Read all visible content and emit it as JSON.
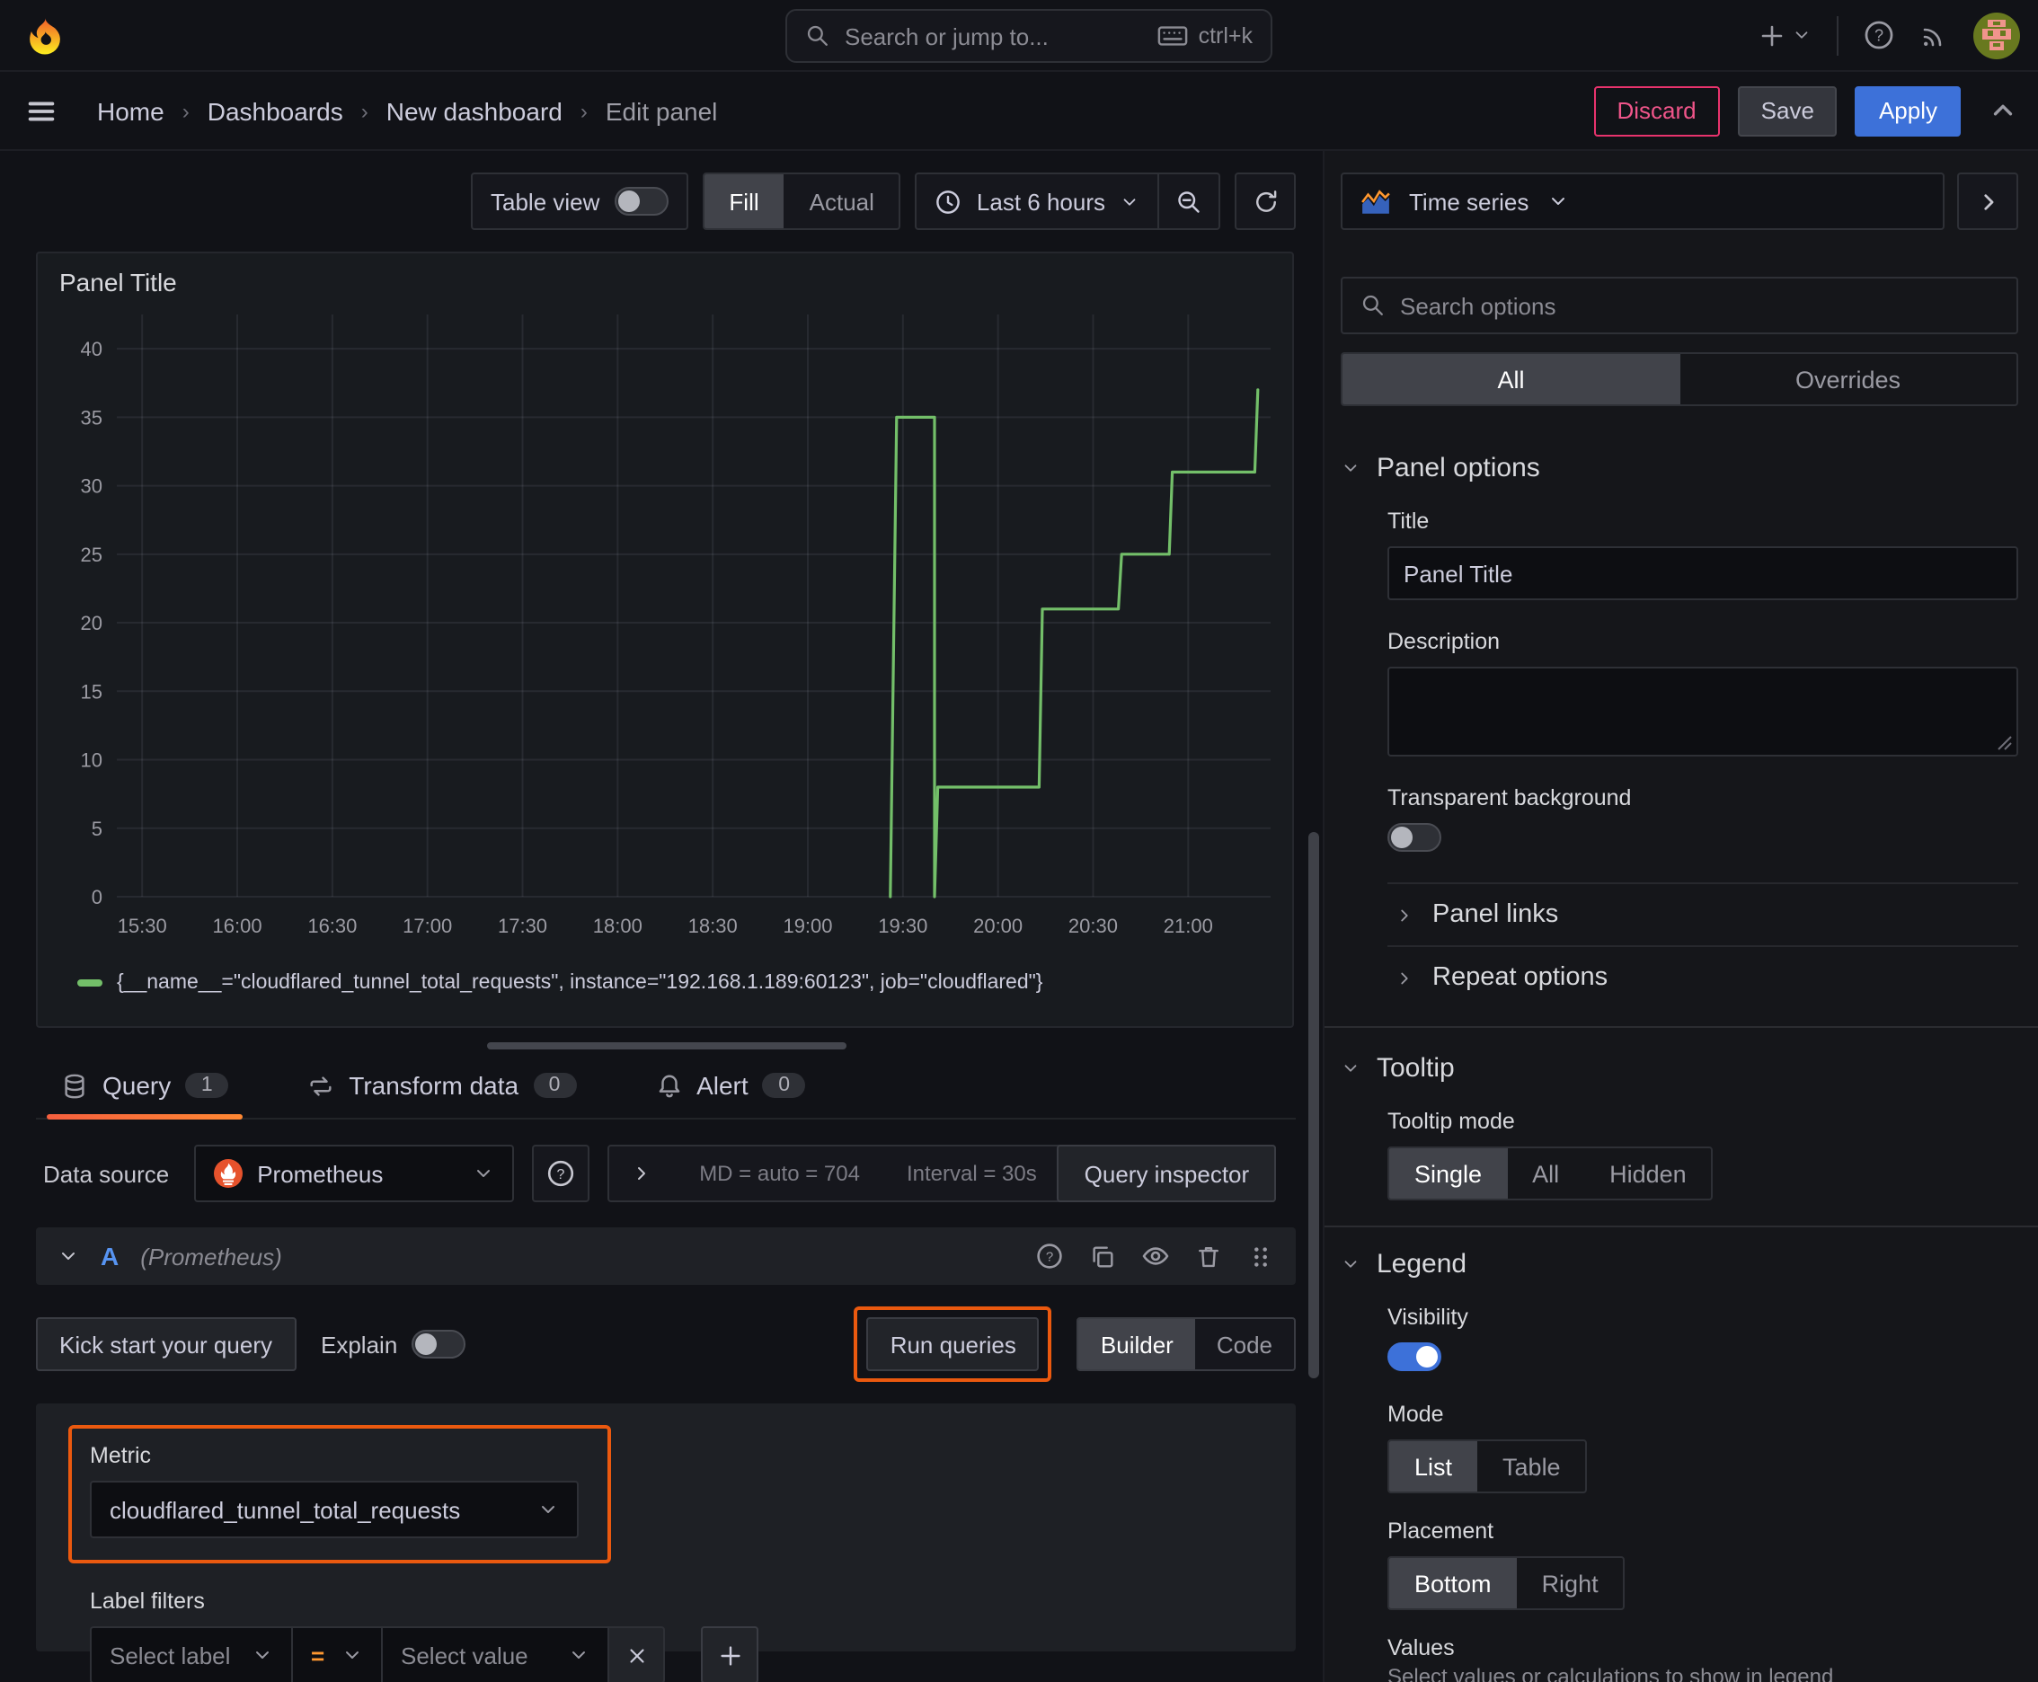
{
  "colors": {
    "accent_orange": "#eb590f",
    "series_green": "#73BF69",
    "primary_blue": "#3d71d9",
    "discard_red": "#e8336d",
    "tab_underline": "#ff8833"
  },
  "topbar": {
    "search_placeholder": "Search or jump to...",
    "search_shortcut": "ctrl+k"
  },
  "breadcrumb": {
    "items": [
      "Home",
      "Dashboards",
      "New dashboard",
      "Edit panel"
    ]
  },
  "actions": {
    "discard": "Discard",
    "save": "Save",
    "apply": "Apply"
  },
  "viz_toolbar": {
    "table_view": "Table view",
    "fill": "Fill",
    "actual": "Actual",
    "time_range": "Last 6 hours"
  },
  "panel": {
    "title": "Panel Title"
  },
  "chart_data": {
    "type": "line",
    "line_style": "step",
    "title": "Panel Title",
    "xlabel": "",
    "ylabel": "",
    "x_ticks": [
      "15:30",
      "16:00",
      "16:30",
      "17:00",
      "17:30",
      "18:00",
      "18:30",
      "19:00",
      "19:30",
      "20:00",
      "20:30",
      "21:00"
    ],
    "x_domain": [
      "15:22",
      "21:26"
    ],
    "y_ticks": [
      0,
      5,
      10,
      15,
      20,
      25,
      30,
      35,
      40
    ],
    "ylim": [
      0,
      42.5
    ],
    "grid": true,
    "legend_position": "bottom",
    "series": [
      {
        "name": "{__name__=\"cloudflared_tunnel_total_requests\", instance=\"192.168.1.189:60123\", job=\"cloudflared\"}",
        "color": "#73BF69",
        "points": [
          [
            "19:26",
            0
          ],
          [
            "19:28",
            35
          ],
          [
            "19:40",
            35
          ],
          [
            "19:40",
            0
          ],
          [
            "19:41",
            8
          ],
          [
            "20:13",
            8
          ],
          [
            "20:14",
            21
          ],
          [
            "20:38",
            21
          ],
          [
            "20:39",
            25
          ],
          [
            "20:54",
            25
          ],
          [
            "20:55",
            31
          ],
          [
            "21:21",
            31
          ],
          [
            "21:22",
            37
          ]
        ]
      }
    ]
  },
  "tabs": {
    "query": "Query",
    "query_count": "1",
    "transform": "Transform data",
    "transform_count": "0",
    "alert": "Alert",
    "alert_count": "0"
  },
  "query": {
    "datasource_label": "Data source",
    "datasource_name": "Prometheus",
    "stats_md": "MD = auto = 704",
    "stats_interval": "Interval = 30s",
    "inspector": "Query inspector",
    "ref_id": "A",
    "ref_ds": "(Prometheus)",
    "kickstart": "Kick start your query",
    "explain": "Explain",
    "run_queries": "Run queries",
    "builder": "Builder",
    "code": "Code",
    "metric_label": "Metric",
    "metric_value": "cloudflared_tunnel_total_requests",
    "label_filters": "Label filters",
    "select_label": "Select label",
    "operator": "=",
    "select_value": "Select value"
  },
  "options": {
    "viz_type": "Time series",
    "search_placeholder": "Search options",
    "tab_all": "All",
    "tab_overrides": "Overrides",
    "panel_options": {
      "header": "Panel options",
      "title_label": "Title",
      "title_value": "Panel Title",
      "description_label": "Description",
      "transparent_label": "Transparent background",
      "panel_links": "Panel links",
      "repeat_options": "Repeat options"
    },
    "tooltip": {
      "header": "Tooltip",
      "mode_label": "Tooltip mode",
      "modes": [
        "Single",
        "All",
        "Hidden"
      ],
      "active_mode": "Single"
    },
    "legend": {
      "header": "Legend",
      "visibility_label": "Visibility",
      "mode_label": "Mode",
      "modes": [
        "List",
        "Table"
      ],
      "active_mode": "List",
      "placement_label": "Placement",
      "placements": [
        "Bottom",
        "Right"
      ],
      "active_placement": "Bottom",
      "values_label": "Values",
      "values_help": "Select values or calculations to show in legend"
    }
  }
}
